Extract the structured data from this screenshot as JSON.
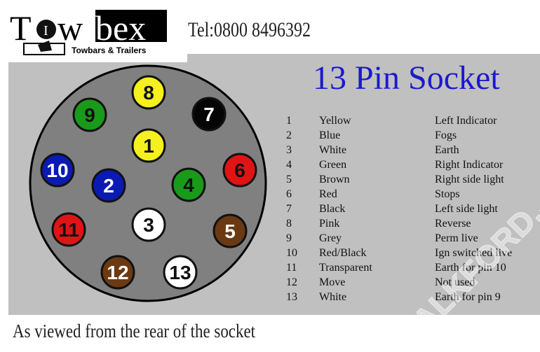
{
  "logo": {
    "text_main": "Towbex",
    "tagline": "Towbars & Trailers"
  },
  "header": {
    "tel": "Tel:0800 8496392"
  },
  "title": "13 Pin Socket",
  "pins": [
    {
      "num": "1",
      "color": "Yellow",
      "function": "Left Indicator",
      "fill": "#f5f01e",
      "text": "#111"
    },
    {
      "num": "2",
      "color": "Blue",
      "function": "Fogs",
      "fill": "#0c1ab4",
      "text": "#fff"
    },
    {
      "num": "3",
      "color": "White",
      "function": "Earth",
      "fill": "#ffffff",
      "text": "#111"
    },
    {
      "num": "4",
      "color": "Green",
      "function": "Right Indicator",
      "fill": "#1a9a1a",
      "text": "#111"
    },
    {
      "num": "5",
      "color": "Brown",
      "function": "Right side light",
      "fill": "#6b3a12",
      "text": "#fff"
    },
    {
      "num": "6",
      "color": "Red",
      "function": "Stops",
      "fill": "#e01414",
      "text": "#111"
    },
    {
      "num": "7",
      "color": "Black",
      "function": "Left side light",
      "fill": "#050505",
      "text": "#fff"
    },
    {
      "num": "8",
      "color": "Pink",
      "function": "Reverse",
      "fill": "#f5f01e",
      "text": "#111"
    },
    {
      "num": "9",
      "color": "Grey",
      "function": "Perm live",
      "fill": "#1a9a1a",
      "text": "#111"
    },
    {
      "num": "10",
      "color": "Red/Black",
      "function": "Ign switched live",
      "fill": "#0c1ab4",
      "text": "#fff"
    },
    {
      "num": "11",
      "color": "Transparent",
      "function": "Earth for pin 10",
      "fill": "#e01414",
      "text": "#111"
    },
    {
      "num": "12",
      "color": "Move",
      "function": "Not used",
      "fill": "#6b3a12",
      "text": "#fff"
    },
    {
      "num": "13",
      "color": "White",
      "function": "Earth for pin 9",
      "fill": "#ffffff",
      "text": "#111"
    }
  ],
  "caption": "As viewed from the rear of the socket",
  "watermark": "TALKFORD.com",
  "colors": {
    "socket": "#808080",
    "panel": "#c0c0c0",
    "title": "#1a1acc"
  }
}
